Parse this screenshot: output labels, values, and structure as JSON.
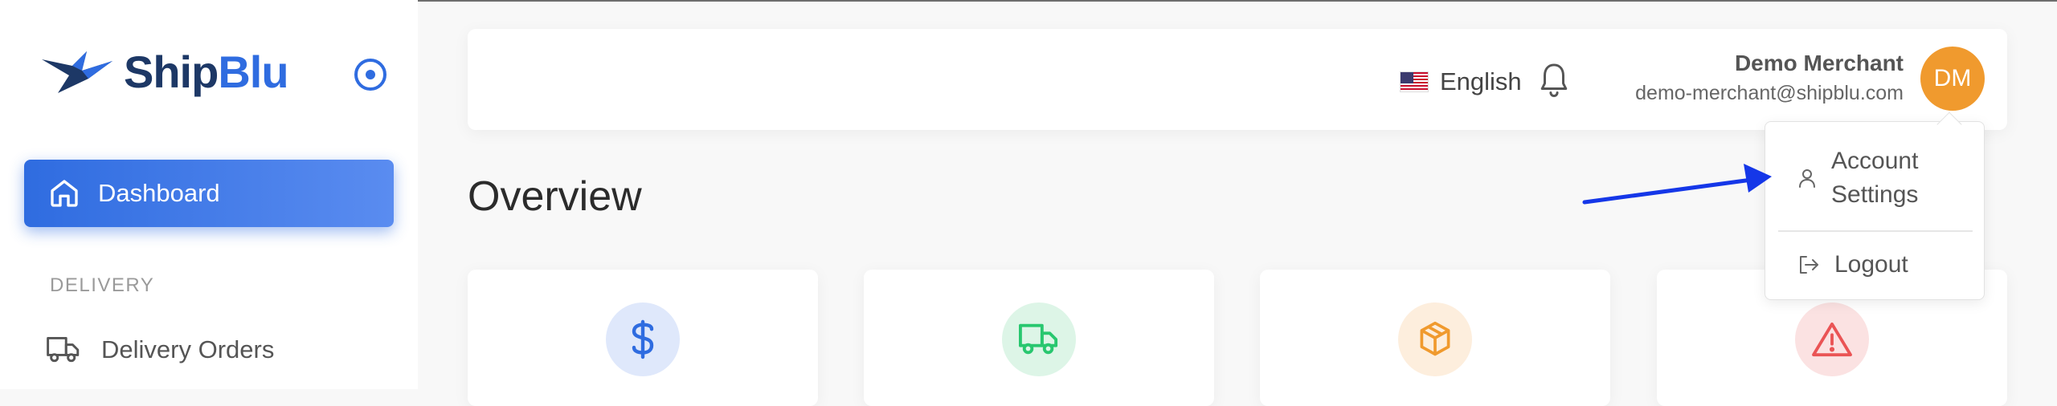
{
  "app": {
    "brand_part1": "Ship",
    "brand_part2": "Blu"
  },
  "sidebar": {
    "active_item": {
      "label": "Dashboard",
      "icon": "home-icon"
    },
    "section_title": "DELIVERY",
    "items": [
      {
        "label": "Delivery Orders",
        "icon": "truck-icon"
      }
    ]
  },
  "header": {
    "language": "English",
    "user_name": "Demo Merchant",
    "user_email": "demo-merchant@shipblu.com",
    "avatar_initials": "DM"
  },
  "main": {
    "title": "Overview"
  },
  "cards": [
    {
      "icon": "dollar-icon",
      "color": "#2f6ce0",
      "bg": "#dfe8fb"
    },
    {
      "icon": "truck-icon",
      "color": "#28c76f",
      "bg": "#ddf5e7"
    },
    {
      "icon": "box-icon",
      "color": "#f09a2e",
      "bg": "#fdeedd"
    },
    {
      "icon": "alert-icon",
      "color": "#ea5455",
      "bg": "#fbe2e2"
    }
  ],
  "dropdown": {
    "account_settings_line1": "Account",
    "account_settings_line2": "Settings",
    "logout": "Logout"
  },
  "colors": {
    "primary": "#2f6ce0",
    "brand_dark": "#1d3866",
    "avatar": "#f09a2e",
    "annotation_arrow": "#1537e8"
  }
}
